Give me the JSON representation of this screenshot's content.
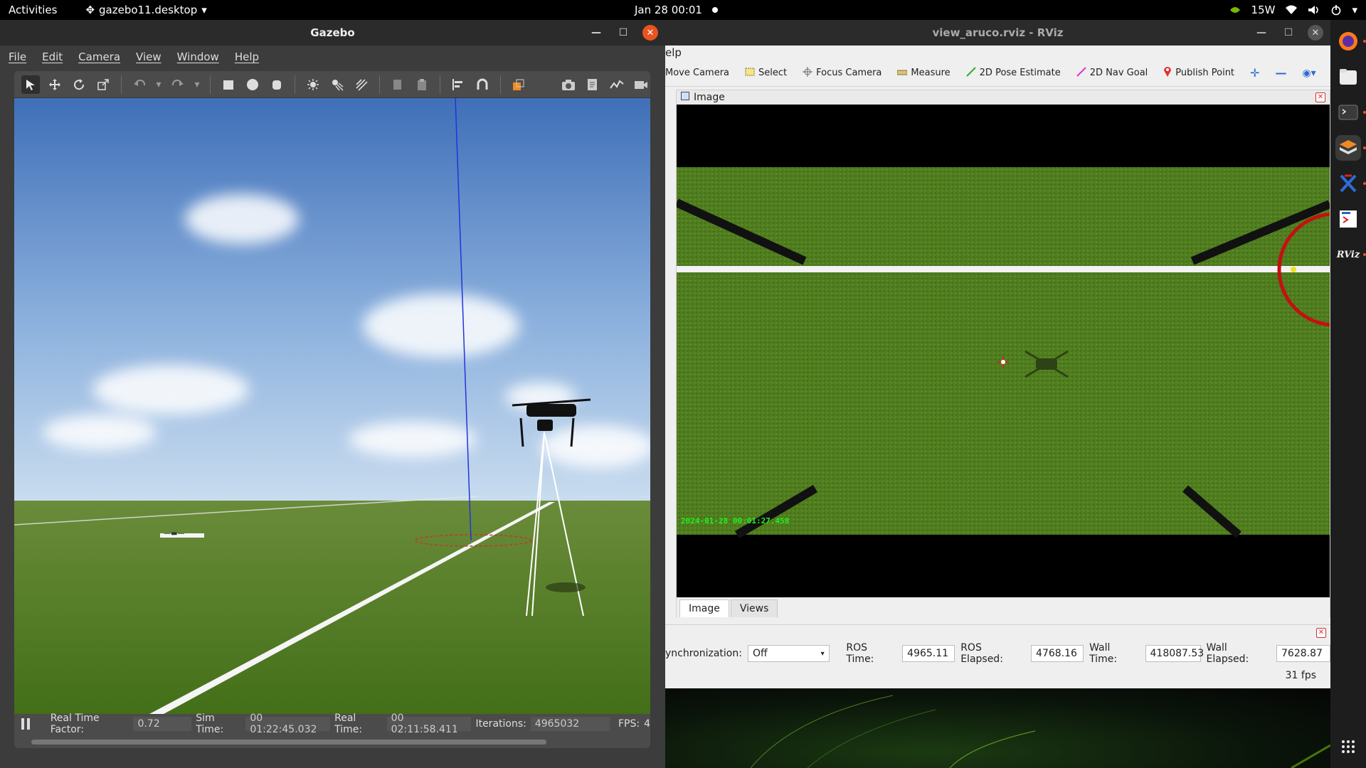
{
  "topbar": {
    "activities": "Activities",
    "app_menu": "gazebo11.desktop",
    "clock": "Jan 28  00:01",
    "power": "15W"
  },
  "gazebo": {
    "title": "Gazebo",
    "menu": [
      "File",
      "Edit",
      "Camera",
      "View",
      "Window",
      "Help"
    ],
    "status": {
      "rtf_label": "Real Time Factor:",
      "rtf_value": "0.72",
      "sim_label": "Sim Time:",
      "sim_value": "00 01:22:45.032",
      "real_label": "Real Time:",
      "real_value": "00 02:11:58.411",
      "iter_label": "Iterations:",
      "iter_value": "4965032",
      "fps_label": "FPS:",
      "fps_value": "4"
    },
    "scene_label": "—▬—"
  },
  "rviz": {
    "title": "view_aruco.rviz - RViz",
    "menu_visible": "elp",
    "tools": [
      "Move Camera",
      "Select",
      "Focus Camera",
      "Measure",
      "2D Pose Estimate",
      "2D Nav Goal",
      "Publish Point"
    ],
    "image_panel_title": "Image",
    "image_timestamp": "2024-01-28 00:01:27.458",
    "tabs": [
      "Image",
      "Views"
    ],
    "time": {
      "sync_label": "ynchronization:",
      "sync_value": "Off",
      "ros_time_label": "ROS Time:",
      "ros_time": "4965.11",
      "ros_elapsed_label": "ROS Elapsed:",
      "ros_elapsed": "4768.16",
      "wall_time_label": "Wall Time:",
      "wall_time": "418087.53",
      "wall_elapsed_label": "Wall Elapsed:",
      "wall_elapsed": "7628.87",
      "fps": "31 fps"
    }
  },
  "dock": {
    "items": [
      "firefox-icon",
      "files-icon",
      "terminal-icon",
      "gazebo-icon",
      "xacro-icon",
      "ros-terminal-icon",
      "rviz-icon",
      "apps-grid-icon"
    ],
    "rviz_text": "RViz"
  },
  "colors": {
    "accent": "#e95420",
    "grass": "#4e7a1f",
    "sky": "#9fbfe6"
  }
}
